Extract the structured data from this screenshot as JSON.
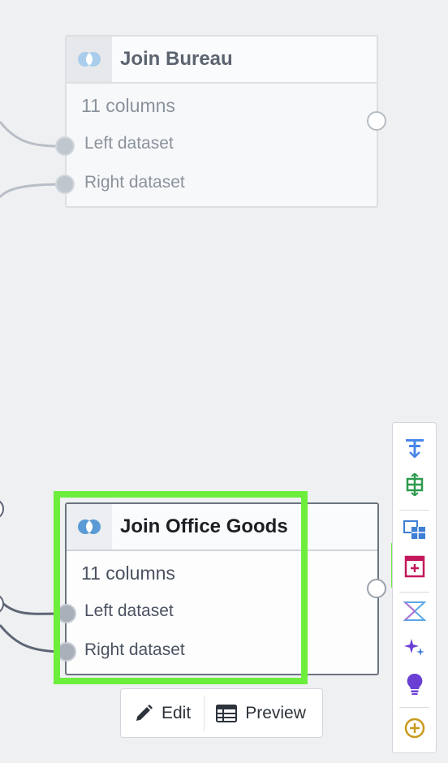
{
  "nodes": {
    "bureau": {
      "title": "Join Bureau",
      "columns": "11 columns",
      "left_port": "Left dataset",
      "right_port": "Right dataset"
    },
    "office": {
      "title": "Join Office Goods",
      "columns": "11 columns",
      "left_port": "Left dataset",
      "right_port": "Right dataset"
    }
  },
  "actions": {
    "edit_label": "Edit",
    "preview_label": "Preview"
  },
  "toolbar": {
    "tools": [
      "filter-icon",
      "pivot-icon",
      "table-grid-icon",
      "add-table-icon",
      "transform-icon",
      "sparkle-icon",
      "lightbulb-icon",
      "add-circle-icon"
    ],
    "selected_tool": "add-table-icon"
  },
  "colors": {
    "highlight": "#6dee3c",
    "join_icon": "#5b9bd5"
  }
}
